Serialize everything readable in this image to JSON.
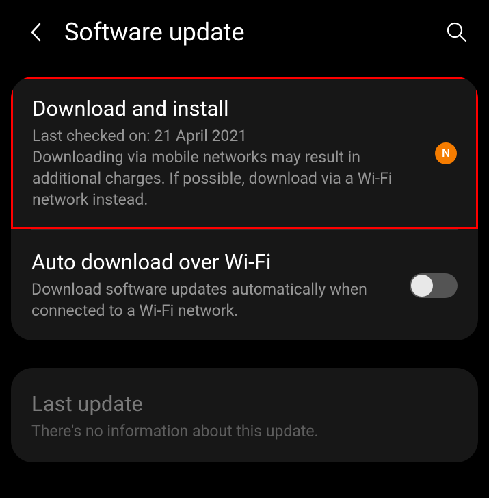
{
  "header": {
    "title": "Software update"
  },
  "card1": {
    "download": {
      "title": "Download and install",
      "desc": "Last checked on: 21 April 2021\nDownloading via mobile networks may result in additional charges. If possible, download via a Wi-Fi network instead.",
      "badge": "N"
    },
    "autodownload": {
      "title": "Auto download over Wi-Fi",
      "desc": "Download software updates automatically when connected to a Wi-Fi network.",
      "toggle": false
    }
  },
  "card2": {
    "lastupdate": {
      "title": "Last update",
      "desc": "There's no information about this update."
    }
  }
}
